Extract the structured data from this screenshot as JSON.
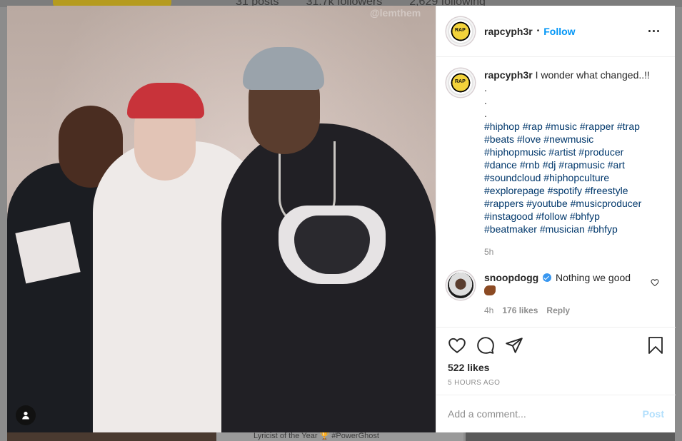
{
  "background": {
    "stats": {
      "posts": "31 posts",
      "followers": "31.7k followers",
      "following": "2,629 following"
    },
    "strip_text": "Lyricist of the Year 🏆 #PowerGhost"
  },
  "photo": {
    "watermark": "@lemthem"
  },
  "post": {
    "author": "rapcyph3r",
    "follow_label": "Follow",
    "separator": "•",
    "caption_text": "I wonder what changed..!!",
    "dots": [
      ".",
      ".",
      "."
    ],
    "hashtags": [
      "#hiphop #rap #music #rapper #trap",
      "#beats #love #newmusic",
      "#hiphopmusic #artist #producer",
      "#dance #rnb #dj #rapmusic #art",
      "#soundcloud #hiphopculture",
      "#explorepage #spotify #freestyle",
      "#rappers #youtube #musicproducer",
      "#instagood #follow #bhfyp",
      "#beatmaker #musician #bhfyp"
    ],
    "caption_age": "5h",
    "likes": "522 likes",
    "time_ago": "5 HOURS AGO"
  },
  "comments": [
    {
      "user": "snoopdogg",
      "text": "Nothing we good",
      "age": "4h",
      "likes": "176 likes",
      "reply_label": "Reply"
    }
  ],
  "composer": {
    "placeholder": "Add a comment...",
    "post_label": "Post"
  },
  "colors": {
    "link": "#0095f6",
    "hashtag": "#00376b",
    "muted": "#8e8e8e",
    "post_disabled": "#b2dffc"
  }
}
